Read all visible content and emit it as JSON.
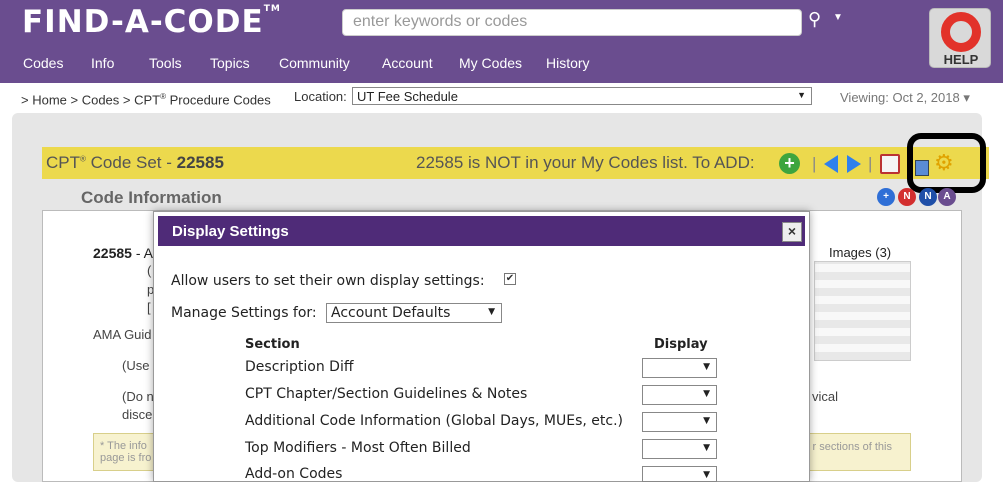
{
  "header": {
    "logo": "FIND-A-CODE",
    "logo_tm": "TM",
    "search_placeholder": "enter keywords or codes",
    "help_label": "HELP",
    "nav": [
      "Codes",
      "Info",
      "Tools",
      "Topics",
      "Community",
      "Account",
      "My Codes",
      "History"
    ]
  },
  "breadcrumb": {
    "prefix": "> Home > Codes > CPT",
    "reg": "®",
    "suffix": " Procedure Codes"
  },
  "location": {
    "label": "Location:",
    "value": "UT Fee Schedule"
  },
  "viewing": "Viewing: Oct 2, 2018 ▾",
  "code_bar": {
    "prefix": "CPT",
    "reg": "®",
    "set_label": " Code Set - ",
    "code": "22585",
    "not_in_list": "22585 is NOT in your My Codes list. To ADD:",
    "add_symbol": "+"
  },
  "code_info": {
    "title": "Code Information",
    "code": "22585",
    "code_rest": " - A",
    "stub1": "(",
    "stub2": "p",
    "stub3": "[",
    "ama": "AMA Guid",
    "use": "(Use",
    "do": "(Do n",
    "disc": "disce",
    "vical": "vical",
    "images": "Images (3)",
    "note_left": "* The info",
    "note_left2": "page is fro",
    "note_right": "r sections of this"
  },
  "modal": {
    "title": "Display Settings",
    "close": "×",
    "allow_label": "Allow users to set their own display settings:",
    "allow_checked": "✔",
    "manage_label": "Manage Settings for:",
    "manage_value": "Account Defaults",
    "col_section": "Section",
    "col_display": "Display",
    "rows": [
      "Description Diff",
      "CPT Chapter/Section Guidelines & Notes",
      "Additional Code Information (Global Days, MUEs, etc.)",
      "Top Modifiers - Most Often Billed",
      "Add-on Codes"
    ]
  },
  "colors": {
    "header_bg": "#6a4d8f",
    "code_bar_bg": "#ecd94d",
    "modal_header_bg": "#4f2b78"
  }
}
